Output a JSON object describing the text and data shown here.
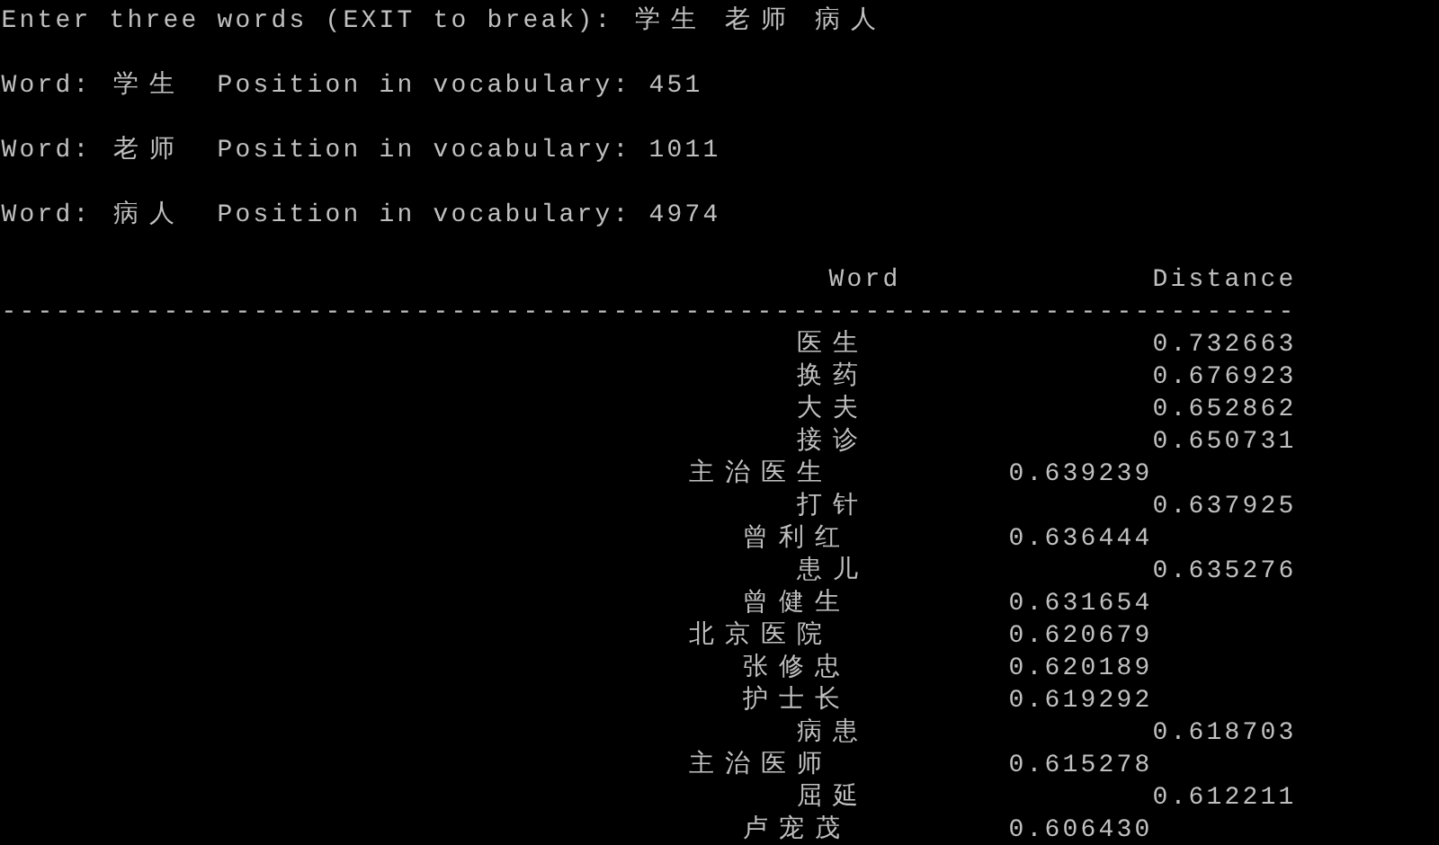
{
  "prompt": "Enter three words (EXIT to break): 学生 老师 病人",
  "query_words": [
    "Word: 学生  Position in vocabulary: 451",
    "Word: 老师  Position in vocabulary: 1011",
    "Word: 病人  Position in vocabulary: 4974"
  ],
  "table": {
    "columns": [
      "Word",
      "Distance"
    ],
    "separator": "------------------------------------------------------------------------",
    "rows": [
      {
        "word": "医生",
        "distance": "0.732663"
      },
      {
        "word": "换药",
        "distance": "0.676923"
      },
      {
        "word": "大夫",
        "distance": "0.652862"
      },
      {
        "word": "接诊",
        "distance": "0.650731"
      },
      {
        "word": "主治医生",
        "distance": "0.639239"
      },
      {
        "word": "打针",
        "distance": "0.637925"
      },
      {
        "word": "曾利红",
        "distance": "0.636444"
      },
      {
        "word": "患儿",
        "distance": "0.635276"
      },
      {
        "word": "曾健生",
        "distance": "0.631654"
      },
      {
        "word": "北京医院",
        "distance": "0.620679"
      },
      {
        "word": "张修忠",
        "distance": "0.620189"
      },
      {
        "word": "护士长",
        "distance": "0.619292"
      },
      {
        "word": "病患",
        "distance": "0.618703"
      },
      {
        "word": "主治医师",
        "distance": "0.615278"
      },
      {
        "word": "屈延",
        "distance": "0.612211"
      },
      {
        "word": "卢宠茂",
        "distance": "0.606430"
      }
    ]
  }
}
